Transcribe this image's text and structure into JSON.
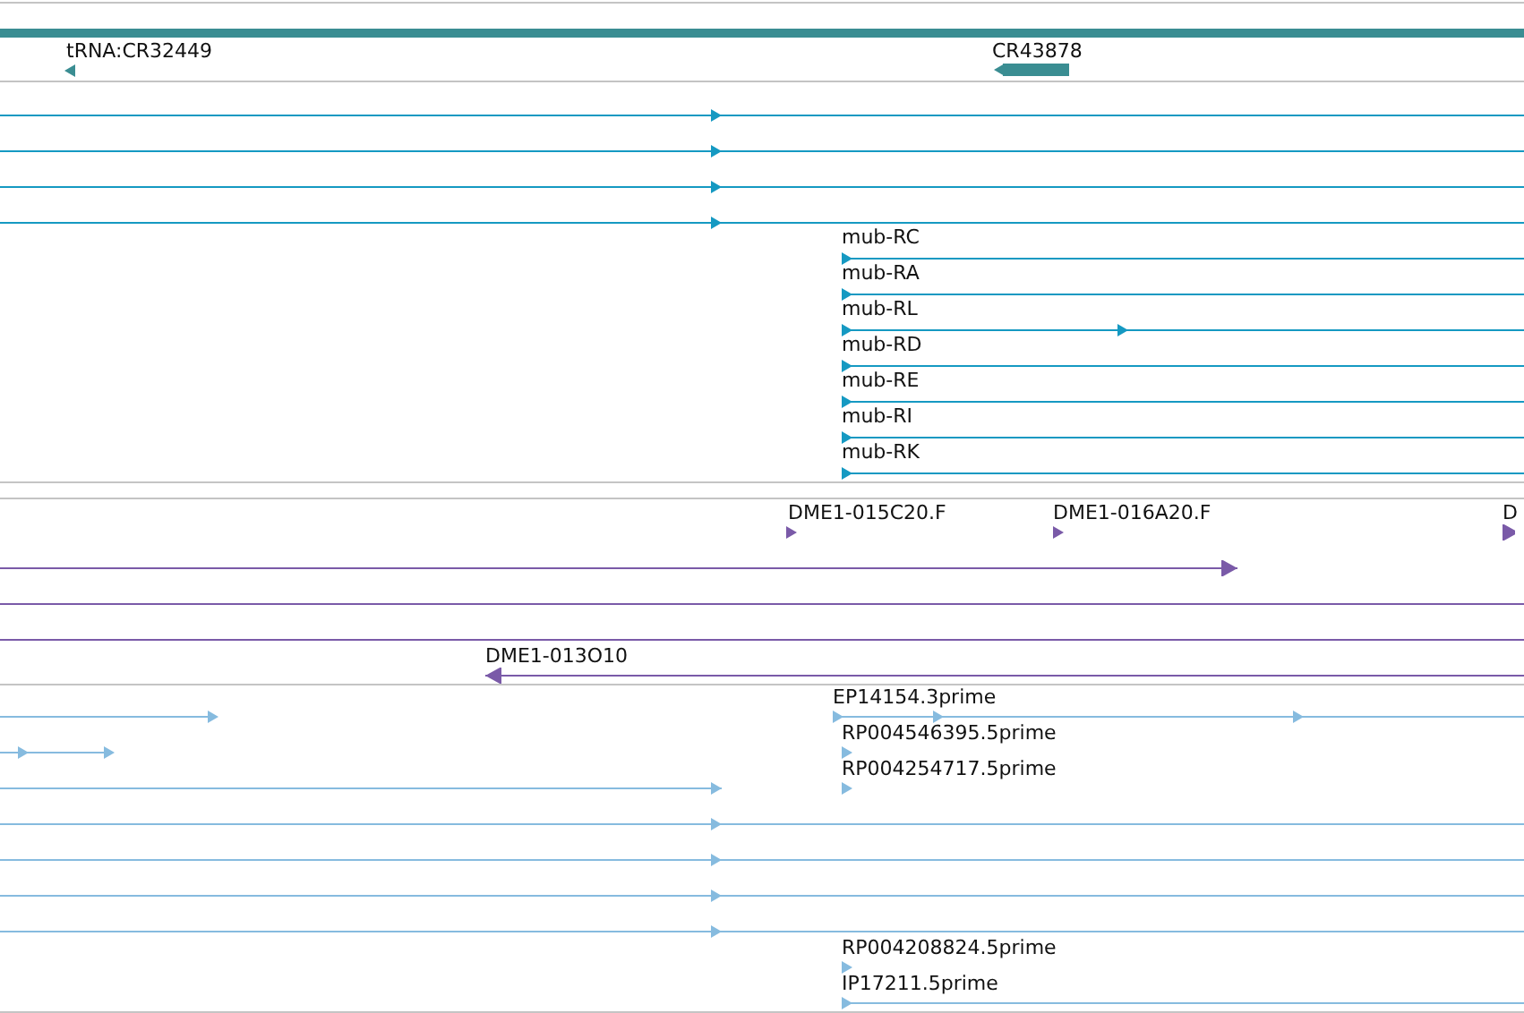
{
  "tracks": [
    {
      "features": [
        {
          "label": "tRNA:CR32449",
          "kind": "marker",
          "reverse": true
        },
        {
          "label": "CR43878",
          "kind": "bar",
          "reverse": true
        }
      ]
    },
    {
      "features": [
        {
          "kind": "arrowed",
          "reverse": false
        },
        {
          "kind": "arrowed",
          "reverse": false
        },
        {
          "kind": "arrowed",
          "reverse": false
        },
        {
          "kind": "arrowed",
          "reverse": false
        },
        {
          "label": "mub-RC",
          "kind": "arrowed",
          "reverse": false
        },
        {
          "label": "mub-RA",
          "kind": "arrowed",
          "reverse": false
        },
        {
          "label": "mub-RL",
          "kind": "arrowed",
          "reverse": false
        },
        {
          "label": "mub-RD",
          "kind": "arrowed",
          "reverse": false
        },
        {
          "label": "mub-RE",
          "kind": "arrowed",
          "reverse": false
        },
        {
          "label": "mub-RI",
          "kind": "arrowed",
          "reverse": false
        },
        {
          "label": "mub-RK",
          "kind": "arrowed",
          "reverse": false
        }
      ]
    },
    {
      "features": [
        {
          "label": "DME1-015C20.F",
          "kind": "marker",
          "reverse": false
        },
        {
          "label": "DME1-016A20.F",
          "kind": "marker",
          "reverse": false
        },
        {
          "label": "D",
          "kind": "marker",
          "reverse": false
        },
        {
          "kind": "arrowed",
          "reverse": false
        },
        {
          "kind": "plain"
        },
        {
          "kind": "plain"
        },
        {
          "label": "DME1-013O10",
          "kind": "arrowed",
          "reverse": true
        }
      ]
    },
    {
      "features": [
        {
          "kind": "arrowed",
          "reverse": false
        },
        {
          "label": "EP14154.3prime",
          "kind": "arrowed",
          "reverse": false
        },
        {
          "kind": "arrowed",
          "reverse": false
        },
        {
          "label": "RP004546395.5prime",
          "kind": "marker",
          "reverse": false
        },
        {
          "label": "RP004254717.5prime",
          "kind": "marker",
          "reverse": false
        },
        {
          "kind": "arrowed",
          "reverse": false
        },
        {
          "kind": "arrowed",
          "reverse": false
        },
        {
          "kind": "arrowed",
          "reverse": false
        },
        {
          "kind": "arrowed",
          "reverse": false
        },
        {
          "kind": "arrowed",
          "reverse": false
        },
        {
          "label": "RP004208824.5prime",
          "kind": "marker",
          "reverse": false
        },
        {
          "label": "IP17211.5prime",
          "kind": "arrowed",
          "reverse": false
        }
      ]
    }
  ]
}
